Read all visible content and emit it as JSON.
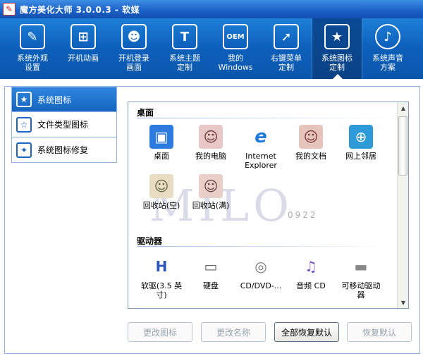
{
  "window": {
    "title": "魔方美化大师 3.0.0.3 - 软媒",
    "icon_name": "cube-app-icon"
  },
  "toolbar": {
    "items": [
      {
        "label": "系统外观\n设置",
        "icon": "brush-icon"
      },
      {
        "label": "开机动画",
        "icon": "windows-logo-icon"
      },
      {
        "label": "开机登录\n画面",
        "icon": "user-portrait-icon"
      },
      {
        "label": "系统主题\n定制",
        "icon": "tshirt-icon"
      },
      {
        "label": "我的\nWindows",
        "icon": "oem-icon"
      },
      {
        "label": "右键菜单\n定制",
        "icon": "cursor-icon"
      },
      {
        "label": "系统图标\n定制",
        "icon": "star-frame-icon"
      },
      {
        "label": "系统声音\n方案",
        "icon": "music-note-icon"
      }
    ],
    "active_index": 6
  },
  "nav": {
    "items": [
      {
        "label": "系统图标",
        "icon": "star-frame-icon"
      },
      {
        "label": "文件类型图标",
        "icon": "star-file-icon"
      },
      {
        "label": "系统图标修复",
        "icon": "wrench-icon"
      }
    ]
  },
  "sections": {
    "desktop": {
      "title": "桌面",
      "items": [
        {
          "label": "桌面",
          "icon": "desktop-icon"
        },
        {
          "label": "我的电脑",
          "icon": "anime-avatar-icon"
        },
        {
          "label": "Internet\nExplorer",
          "icon": "ie-icon"
        },
        {
          "label": "我的文档",
          "icon": "anime-avatar-icon"
        },
        {
          "label": "网上邻居",
          "icon": "network-computer-icon"
        },
        {
          "label": "回收站(空)",
          "icon": "anime-avatar-icon"
        },
        {
          "label": "回收站(满)",
          "icon": "anime-avatar-icon"
        }
      ]
    },
    "drives": {
      "title": "驱动器",
      "items": [
        {
          "label": "软驱(3.5 英\n寸)",
          "icon": "floppy-drive-icon"
        },
        {
          "label": "硬盘",
          "icon": "hard-disk-icon"
        },
        {
          "label": "CD/DVD-...",
          "icon": "cd-drive-icon"
        },
        {
          "label": "音频 CD",
          "icon": "audio-cd-icon"
        },
        {
          "label": "可移动驱动\n器",
          "icon": "removable-drive-icon"
        }
      ]
    }
  },
  "watermark": {
    "text": "MILO",
    "sub": "0922"
  },
  "buttons": {
    "change_icon": "更改图标",
    "change_name": "更改名称",
    "restore_all": "全部恢复默认",
    "restore_default": "恢复默认"
  },
  "colors": {
    "toolbar": "#0d5fba",
    "accent": "#1a66c4",
    "selected_nav": "#1665c1"
  }
}
